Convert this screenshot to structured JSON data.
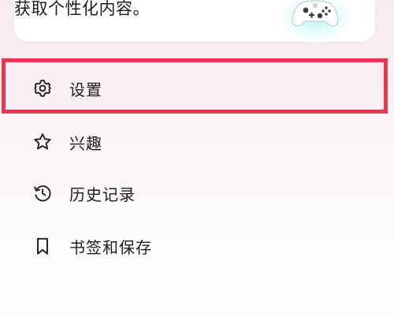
{
  "promo_card": {
    "text": "获取个性化内容。",
    "image_icon": "game-controller-icon",
    "glow_color": "#7fecf0"
  },
  "menu": {
    "items": [
      {
        "label": "设置",
        "icon": "gear-icon",
        "highlighted": true
      },
      {
        "label": "兴趣",
        "icon": "star-icon",
        "highlighted": false
      },
      {
        "label": "历史记录",
        "icon": "history-icon",
        "highlighted": false
      },
      {
        "label": "书签和保存",
        "icon": "bookmark-icon",
        "highlighted": false
      }
    ]
  },
  "colors": {
    "highlight_border": "#e8374f",
    "background_top": "#f6ebf1",
    "background_bottom": "#ffffff"
  }
}
